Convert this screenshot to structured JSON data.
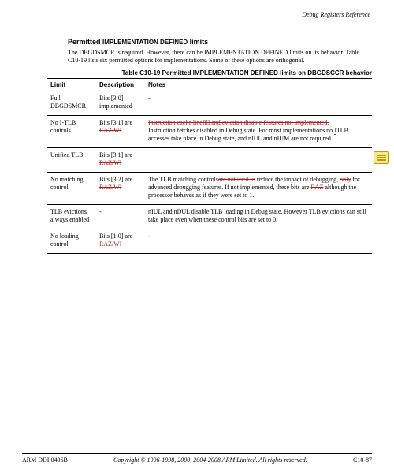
{
  "header": {
    "running": "Debug Registers Reference"
  },
  "section": {
    "title_prefix": "Permitted ",
    "title_sc": "IMPLEMENTATION DEFINED",
    "title_suffix": " limits",
    "para1": "The DBGDSMCR is required. However, there can be IMPLEMENTATION DEFINED limits on its behavior. Table C10-19 lists six permitted options for implementations. Some of these options are orthogonal."
  },
  "chart_data": {
    "type": "table",
    "caption_prefix": "Table C10-19 Permitted ",
    "caption_sc": "IMPLEMENTATION DEFINED",
    "caption_suffix": " limits on DBGDSCCR behavior",
    "columns": [
      "Limit",
      "Description",
      "Notes"
    ],
    "rows": [
      {
        "limit": "Full DBGDSMCR",
        "desc": "Bits [3:0] implemented",
        "notes": {
          "plain": "-"
        }
      },
      {
        "limit": "No I-TLB controls",
        "desc_a": "Bits [3,1] are ",
        "desc_del": "RAZ/WI",
        "notes": {
          "del": "Instruction cache linefill and eviction disable features not implemented.",
          "plain": "Instruction fetches disabled in Debug state. For most implementations no TLB accesses take place in Debug state, and nIUL and nIUM are not required.",
          "ins_word": "I"
        }
      },
      {
        "limit": "Unified TLB",
        "desc_a": "Bits [3,1] are ",
        "desc_del": "RAZ/WI",
        "notes": {
          "plain": ""
        }
      },
      {
        "limit": "No matching control",
        "desc_a": "Bits [3:2] are ",
        "desc_del": "RAZ/WI",
        "notes": {
          "pre": "The TLB matching controls",
          "del1": "are not used to",
          "mid": " reduce the impact of debugging, ",
          "del2": "only",
          "post": " for advanced debugging features. If not implemented, these bits are ",
          "raz": "RAZ",
          "tail": " although the processor behaves as if they were set to 1."
        }
      },
      {
        "limit": "TLB evictions always enabled",
        "desc_a": "-",
        "notes": {
          "plain": "nIUL and nDUL disable TLB loading in Debug state. However TLB evictions can still take place even when these control bits are set to 0."
        }
      },
      {
        "limit": "No loading control",
        "desc_a": "Bits [1:0] are ",
        "desc_del": "RAZ/WI",
        "notes": {
          "plain": "-"
        }
      }
    ]
  },
  "footer": {
    "left": "ARM DDI 0406B",
    "center": "Copyright © 1996-1998, 2000, 2004-2008 ARM Limited. All rights reserved.",
    "right": "C10-87"
  }
}
